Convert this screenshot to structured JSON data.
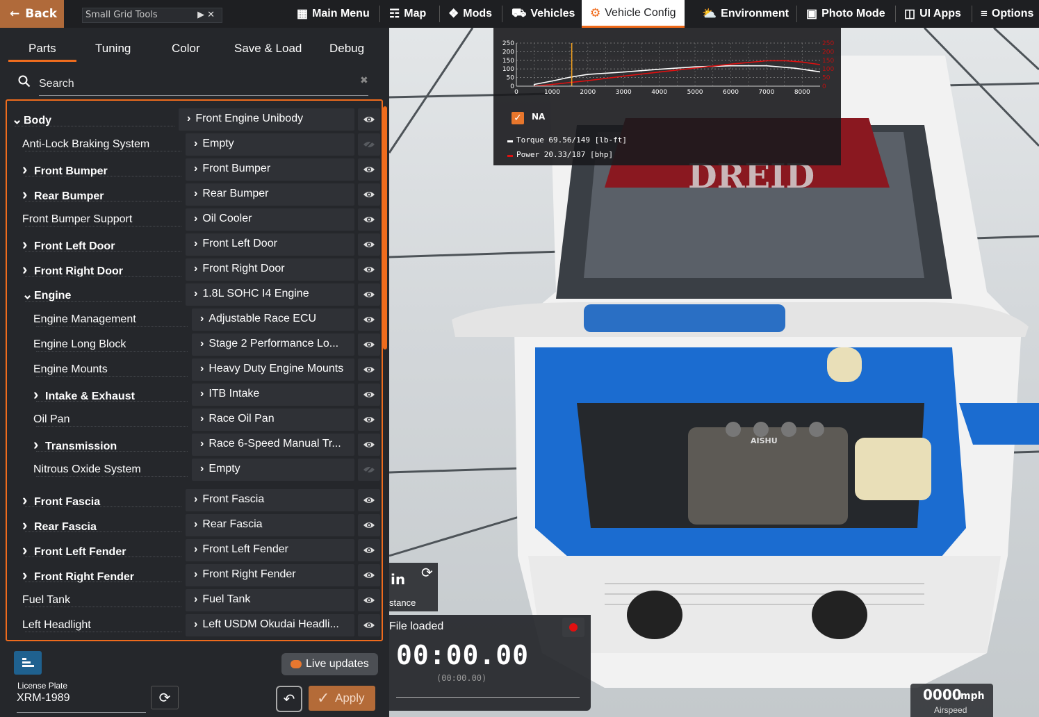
{
  "topbar": {
    "back_label": "Back",
    "app_select": "Small Grid Tools",
    "nav": [
      {
        "label": "Main Menu",
        "icon": "grid-plus-icon"
      },
      {
        "label": "Map",
        "icon": "map-icon"
      },
      {
        "label": "Mods",
        "icon": "puzzle-icon"
      },
      {
        "label": "Vehicles",
        "icon": "car-icon"
      },
      {
        "label": "Vehicle Config",
        "icon": "engine-icon"
      },
      {
        "label": "Environment",
        "icon": "weather-icon"
      },
      {
        "label": "Photo Mode",
        "icon": "camera-icon"
      },
      {
        "label": "UI Apps",
        "icon": "apps-icon"
      },
      {
        "label": "Options",
        "icon": "sliders-icon"
      }
    ]
  },
  "panel": {
    "tabs": [
      "Parts",
      "Tuning",
      "Color",
      "Save & Load",
      "Debug"
    ],
    "search_placeholder": "Search",
    "rows": [
      {
        "label": "Body",
        "bold": true,
        "chev": "down",
        "indent": 0,
        "slot": "Front Engine Unibody",
        "visible": true
      },
      {
        "label": "Anti-Lock Braking System",
        "bold": false,
        "chev": "",
        "indent": 1,
        "slot": "Empty",
        "visible": false
      },
      {
        "label": "Front Bumper",
        "bold": true,
        "chev": "right",
        "indent": 1,
        "slot": "Front Bumper",
        "visible": true
      },
      {
        "label": "Rear Bumper",
        "bold": true,
        "chev": "right",
        "indent": 1,
        "slot": "Rear Bumper",
        "visible": true
      },
      {
        "label": "Front Bumper Support",
        "bold": false,
        "chev": "",
        "indent": 1,
        "slot": "Oil Cooler",
        "visible": true
      },
      {
        "label": "Front Left Door",
        "bold": true,
        "chev": "right",
        "indent": 1,
        "slot": "Front Left Door",
        "visible": true
      },
      {
        "label": "Front Right Door",
        "bold": true,
        "chev": "right",
        "indent": 1,
        "slot": "Front Right Door",
        "visible": true
      },
      {
        "label": "Engine",
        "bold": true,
        "chev": "down",
        "indent": 1,
        "slot": "1.8L SOHC I4 Engine",
        "visible": true
      },
      {
        "label": "Engine Management",
        "bold": false,
        "chev": "",
        "indent": 2,
        "slot": "Adjustable Race ECU",
        "visible": true
      },
      {
        "label": "Engine Long Block",
        "bold": false,
        "chev": "",
        "indent": 2,
        "slot": "Stage 2 Performance Lo...",
        "visible": true
      },
      {
        "label": "Engine Mounts",
        "bold": false,
        "chev": "",
        "indent": 2,
        "slot": "Heavy Duty Engine Mounts",
        "visible": true
      },
      {
        "label": "Intake & Exhaust",
        "bold": true,
        "chev": "right",
        "indent": 2,
        "slot": "ITB Intake",
        "visible": true
      },
      {
        "label": "Oil Pan",
        "bold": false,
        "chev": "",
        "indent": 2,
        "slot": "Race Oil Pan",
        "visible": true
      },
      {
        "label": "Transmission",
        "bold": true,
        "chev": "right",
        "indent": 2,
        "slot": "Race 6-Speed Manual Tr...",
        "visible": true
      },
      {
        "label": "Nitrous Oxide System",
        "bold": false,
        "chev": "",
        "indent": 2,
        "slot": "Empty",
        "visible": false
      },
      {
        "label": "Front Fascia",
        "bold": true,
        "chev": "right",
        "indent": 1,
        "slot": "Front Fascia",
        "visible": true
      },
      {
        "label": "Rear Fascia",
        "bold": true,
        "chev": "right",
        "indent": 1,
        "slot": "Rear Fascia",
        "visible": true
      },
      {
        "label": "Front Left Fender",
        "bold": true,
        "chev": "right",
        "indent": 1,
        "slot": "Front Left Fender",
        "visible": true
      },
      {
        "label": "Front Right Fender",
        "bold": true,
        "chev": "right",
        "indent": 1,
        "slot": "Front Right Fender",
        "visible": true
      },
      {
        "label": "Fuel Tank",
        "bold": false,
        "chev": "",
        "indent": 1,
        "slot": "Fuel Tank",
        "visible": true
      },
      {
        "label": "Left Headlight",
        "bold": false,
        "chev": "",
        "indent": 1,
        "slot": "Left USDM Okudai Headli...",
        "visible": true
      }
    ],
    "license_label": "License Plate",
    "license_value": "XRM-1989",
    "live_updates_label": "Live updates",
    "apply_label": "Apply"
  },
  "graph": {
    "left_ticks": [
      "250",
      "200",
      "150",
      "100",
      "50",
      "0"
    ],
    "right_ticks": [
      "250",
      "200",
      "150",
      "100",
      "50",
      "0"
    ],
    "x_ticks": [
      "0",
      "1000",
      "2000",
      "3000",
      "4000",
      "5000",
      "6000",
      "7000",
      "8000"
    ],
    "na_label": "NA",
    "torque_label": "Torque 69.56/149 [lb-ft]",
    "power_label": "Power 20.33/187 [bhp]",
    "colors": {
      "torque": "#ffffff",
      "power": "#e01010",
      "rpm_marker": "#f0a020"
    }
  },
  "stopwatch": {
    "side_title": "in",
    "side_sub": "stance",
    "status": "File loaded",
    "time": "00:00.00",
    "sub_time": "(00:00.00)"
  },
  "speedo": {
    "value": "0000",
    "unit": "mph",
    "label": "Airspeed"
  },
  "scene": {
    "decal_text": "DREID",
    "engine_text": "AISHU"
  }
}
